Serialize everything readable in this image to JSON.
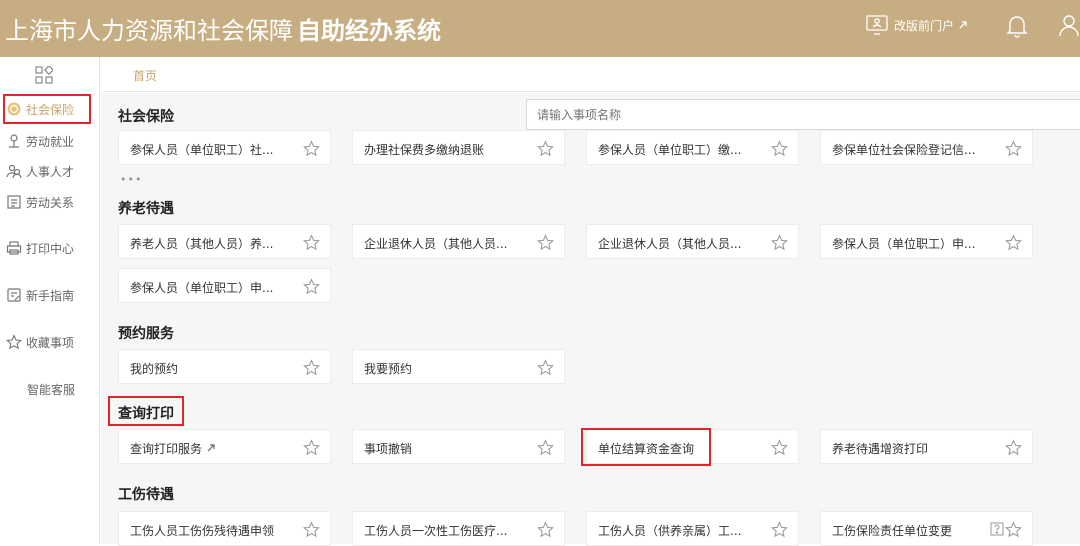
{
  "header": {
    "title": "上海市人力资源和社会保障",
    "title_bold": "自助经办系统",
    "portal_label": "改版前门户"
  },
  "sidebar": {
    "items": [
      {
        "label": "社会保险",
        "icon": "coin-icon"
      },
      {
        "label": "劳动就业",
        "icon": "person-icon"
      },
      {
        "label": "人事人才",
        "icon": "people-icon"
      },
      {
        "label": "劳动关系",
        "icon": "document-icon"
      },
      {
        "label": "打印中心",
        "icon": "printer-icon"
      },
      {
        "label": "新手指南",
        "icon": "guide-icon"
      },
      {
        "label": "收藏事项",
        "icon": "star-icon"
      },
      {
        "label": "智能客服",
        "icon": ""
      }
    ]
  },
  "breadcrumb": "首页",
  "search": {
    "placeholder": "请输入事项名称"
  },
  "sections": [
    {
      "title": "社会保险",
      "items": [
        "参保人员（单位职工）社...",
        "办理社保费多缴纳退账",
        "参保人员（单位职工）缴...",
        "参保单位社会保险登记信..."
      ],
      "more": "•••"
    },
    {
      "title": "养老待遇",
      "items": [
        "养老人员（其他人员）养...",
        "企业退休人员（其他人员...",
        "企业退休人员（其他人员...",
        "参保人员（单位职工）申...",
        "参保人员（单位职工）申..."
      ]
    },
    {
      "title": "预约服务",
      "items": [
        "我的预约",
        "我要预约"
      ]
    },
    {
      "title": "查询打印",
      "items": [
        "查询打印服务",
        "事项撤销",
        "单位结算资金查询",
        "养老待遇增资打印"
      ]
    },
    {
      "title": "工伤待遇",
      "items": [
        "工伤人员工伤伤残待遇申领",
        "工伤人员一次性工伤医疗...",
        "工伤人员（供养亲属）工...",
        "工伤保险责任单位变更"
      ]
    }
  ],
  "colors": {
    "header": "#c6ad82",
    "accent": "#c6a36a",
    "highlight": "#e0262c"
  }
}
